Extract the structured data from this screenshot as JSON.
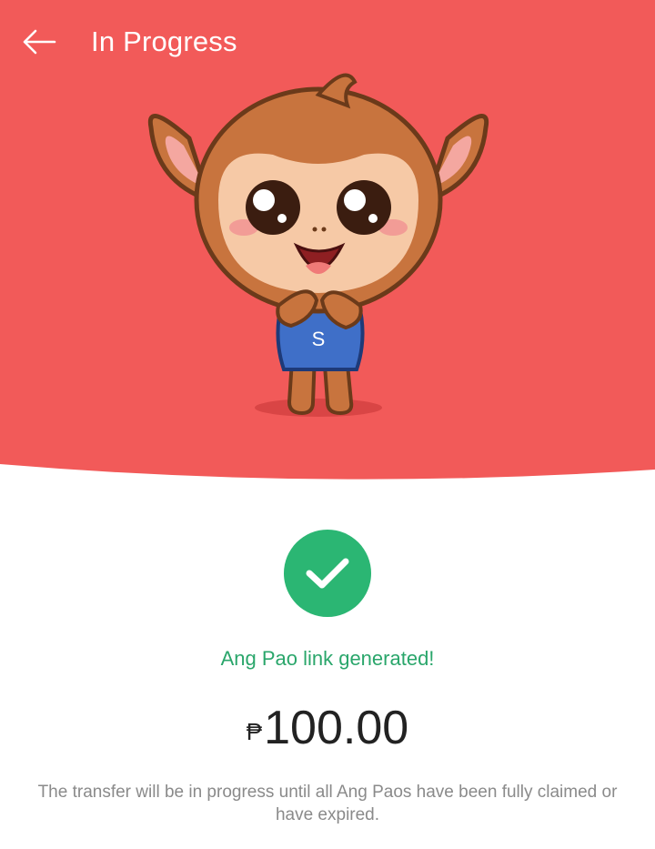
{
  "header": {
    "title": "In Progress",
    "back_icon": "arrow-left-icon"
  },
  "hero": {
    "background_color": "#f25a59",
    "mascot": "monkey-mascot",
    "shirt_letter": "S"
  },
  "status": {
    "icon": "check-icon",
    "icon_color": "#2bb673",
    "message": "Ang Pao link generated!"
  },
  "amount": {
    "currency_symbol": "₱",
    "value": "100.00"
  },
  "note": "The transfer will be in progress until all Ang Paos have been fully claimed or have expired."
}
